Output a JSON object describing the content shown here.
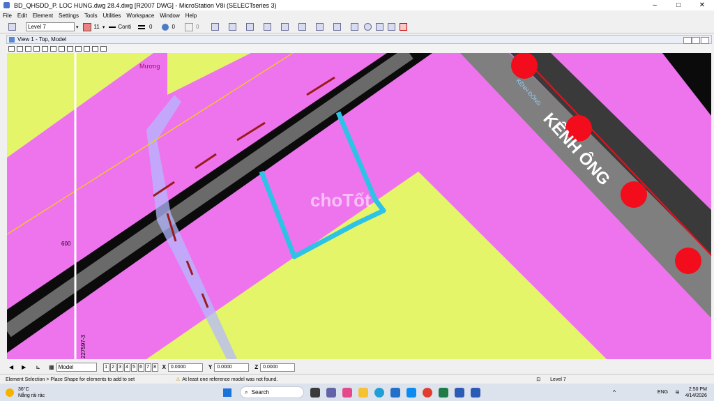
{
  "window": {
    "title": "BD_QHSDD_P. LOC HUNG.dwg 28.4.dwg [R2007 DWG] - MicroStation V8i (SELECTseries 3)",
    "controls": [
      "–",
      "□",
      "✕"
    ]
  },
  "menu": [
    "File",
    "Edit",
    "Element",
    "Settings",
    "Tools",
    "Utilities",
    "Workspace",
    "Window",
    "Help"
  ],
  "toolbar": {
    "level": "Level 7",
    "color": "11",
    "line_style": "Conti",
    "weight": "0",
    "transparency": "0",
    "priority": "0"
  },
  "view": {
    "title": "View 1 - Top, Model",
    "model": "Model",
    "pages": [
      "1",
      "2",
      "3",
      "4",
      "5",
      "6",
      "7",
      "8"
    ]
  },
  "coords": {
    "x_label": "X",
    "x": "0.0000",
    "y_label": "Y",
    "y": "0.0000",
    "z_label": "Z",
    "z": "0.0000"
  },
  "status": {
    "prompt": "Element Selection > Place Shape for elements to add to set",
    "warning": "At least one reference model was not found.",
    "level": "Level 7"
  },
  "map_labels": {
    "road_name": "KÊNH ÔNG",
    "canal": "Mương",
    "street_small": "KÊNH ĐÔNG",
    "grid_number": "600",
    "grid_number_side": "227597-3",
    "watermark": "choTốt"
  },
  "colors": {
    "residential": "#ee74ee",
    "agricultural": "#e4f56a",
    "road": "#0b0b0b",
    "parcel_outline": "#2ec3e6",
    "marker": "#f20c1c"
  },
  "taskbar": {
    "weather_temp": "36°C",
    "weather_text": "Nắng rải rác",
    "search": "Search",
    "lang": "ENG",
    "time": "2:50 PM",
    "date": "4/14/2026"
  }
}
